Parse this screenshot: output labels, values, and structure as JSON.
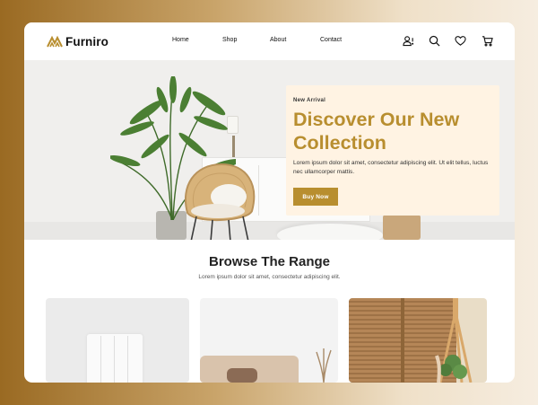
{
  "brand": {
    "name": "Furniro",
    "accent": "#B88E2F"
  },
  "nav": [
    "Home",
    "Shop",
    "About",
    "Contact"
  ],
  "header_icons": [
    "account-alert-icon",
    "search-icon",
    "heart-icon",
    "cart-icon"
  ],
  "hero": {
    "kicker": "New Arrival",
    "title": "Discover Our New Collection",
    "text": "Lorem ipsum dolor sit amet, consectetur adipiscing elit. Ut elit tellus, luctus nec ullamcorper mattis.",
    "button": "Buy Now"
  },
  "browse": {
    "title": "Browse The Range",
    "subtitle": "Lorem ipsum dolor sit amet, consectetur adipiscing elit."
  }
}
